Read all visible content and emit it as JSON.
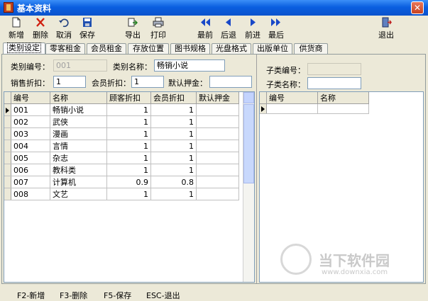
{
  "window": {
    "title": "基本资料",
    "close_symbol": "✕"
  },
  "toolbar": {
    "new": "新增",
    "delete": "删除",
    "cancel": "取消",
    "save": "保存",
    "export": "导出",
    "print": "打印",
    "first": "最前",
    "prev": "后退",
    "next": "前进",
    "last": "最后",
    "exit": "退出"
  },
  "tabs": [
    "类别设定",
    "零客租金",
    "会员租金",
    "存放位置",
    "图书规格",
    "光盘格式",
    "出版单位",
    "供货商"
  ],
  "form": {
    "category_no_label": "类别编号：",
    "category_no_value": "001",
    "category_name_label": "类别名称：",
    "category_name_value": "畅销小说",
    "sale_discount_label": "销售折扣：",
    "sale_discount_value": "1",
    "member_discount_label": "会员折扣：",
    "member_discount_value": "1",
    "default_deposit_label": "默认押金：",
    "default_deposit_value": "",
    "sub_no_label": "子类编号：",
    "sub_no_value": "",
    "sub_name_label": "子类名称：",
    "sub_name_value": ""
  },
  "main_grid": {
    "columns": [
      "编号",
      "名称",
      "顾客折扣",
      "会员折扣",
      "默认押金"
    ],
    "rows": [
      [
        "001",
        "畅销小说",
        "1",
        "1",
        ""
      ],
      [
        "002",
        "武侠",
        "1",
        "1",
        ""
      ],
      [
        "003",
        "漫画",
        "1",
        "1",
        ""
      ],
      [
        "004",
        "言情",
        "1",
        "1",
        ""
      ],
      [
        "005",
        "杂志",
        "1",
        "1",
        ""
      ],
      [
        "006",
        "教科类",
        "1",
        "1",
        ""
      ],
      [
        "007",
        "计算机",
        "0.9",
        "0.8",
        ""
      ],
      [
        "008",
        "文艺",
        "1",
        "1",
        ""
      ]
    ]
  },
  "sub_grid": {
    "columns": [
      "编号",
      "名称"
    ]
  },
  "status": {
    "f2": "F2-新增",
    "f3": "F3-删除",
    "f5": "F5-保存",
    "esc": "ESC-退出"
  },
  "watermark": {
    "text": "当下软件园",
    "url": "www.downxia.com"
  }
}
